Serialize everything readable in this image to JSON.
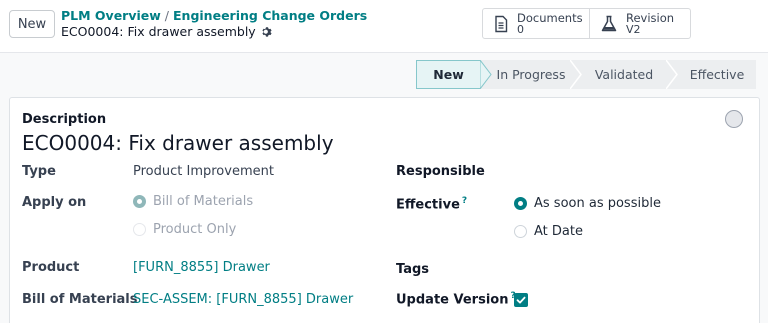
{
  "toolbar": {
    "new_label": "New"
  },
  "breadcrumb": {
    "parent1": "PLM Overview",
    "separator": "/",
    "parent2": "Engineering Change Orders",
    "current": "ECO0004: Fix drawer assembly"
  },
  "smart_buttons": [
    {
      "label": "Documents",
      "value": "0",
      "icon": "document-icon"
    },
    {
      "label": "Revision",
      "value": "V2",
      "icon": "flask-icon"
    }
  ],
  "stages": [
    {
      "label": "New",
      "active": true
    },
    {
      "label": "In Progress",
      "active": false
    },
    {
      "label": "Validated",
      "active": false
    },
    {
      "label": "Effective",
      "active": false
    }
  ],
  "form": {
    "description_label": "Description",
    "description_value": "ECO0004: Fix drawer assembly",
    "type_label": "Type",
    "type_value": "Product Improvement",
    "apply_on_label": "Apply on",
    "apply_on_options": [
      "Bill of Materials",
      "Product Only"
    ],
    "apply_on_selected": "Bill of Materials",
    "product_label": "Product",
    "product_value": "[FURN_8855] Drawer",
    "bom_label": "Bill of Materials",
    "bom_value": "SEC-ASSEM: [FURN_8855] Drawer",
    "responsible_label": "Responsible",
    "effective_label": "Effective",
    "effective_options": [
      "As soon as possible",
      "At Date"
    ],
    "effective_selected": "As soon as possible",
    "tags_label": "Tags",
    "update_version_label": "Update Version",
    "update_version_checked": true,
    "help_mark": "?"
  },
  "colors": {
    "accent": "#017e84",
    "active_stage_bg": "#e6f4f5"
  }
}
